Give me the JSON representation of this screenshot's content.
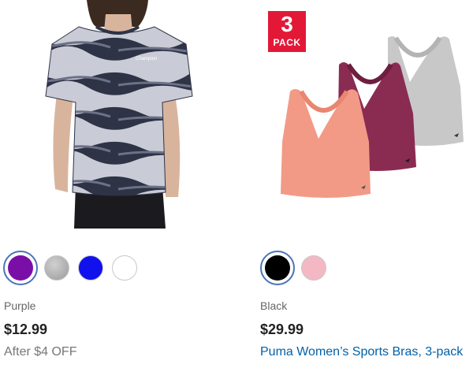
{
  "products": [
    {
      "swatches": [
        {
          "name": "purple",
          "color": "#7a0fa8",
          "selected": true
        },
        {
          "name": "gray",
          "color": "#a9a9a9",
          "selected": false
        },
        {
          "name": "blue",
          "color": "#1111ee",
          "selected": false
        },
        {
          "name": "white",
          "color": "#ffffff",
          "selected": false
        }
      ],
      "color_label": "Purple",
      "price": "$12.99",
      "promo": "After $4 OFF"
    },
    {
      "badge": {
        "number": "3",
        "word": "PACK"
      },
      "swatches": [
        {
          "name": "black",
          "color": "#000000",
          "selected": true
        },
        {
          "name": "pink",
          "color": "#f4b8c4",
          "selected": false
        }
      ],
      "color_label": "Black",
      "price": "$29.99",
      "title": "Puma Women’s Sports Bras, 3-pack"
    }
  ],
  "colors": {
    "link": "#0060a9",
    "selected_ring": "#4a74b8",
    "badge_red": "#e31837",
    "tee_dark": "#2e3346",
    "tee_light": "#c9cbd6",
    "bra_coral": "#f29a86",
    "bra_plum": "#8a2b52",
    "bra_gray": "#c8c8c8"
  }
}
